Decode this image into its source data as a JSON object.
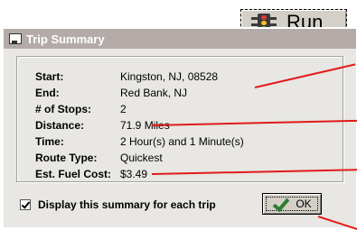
{
  "toolbar": {
    "run_label": "Run"
  },
  "dialog": {
    "title": "Trip Summary",
    "rows": [
      {
        "key": "Start:",
        "value": "Kingston, NJ, 08528"
      },
      {
        "key": "End:",
        "value": "Red Bank, NJ"
      },
      {
        "key": "# of Stops:",
        "value": "2"
      },
      {
        "key": "Distance:",
        "value": "71.9 Miles"
      },
      {
        "key": "Time:",
        "value": "2 Hour(s) and 1 Minute(s)"
      },
      {
        "key": "Route Type:",
        "value": "Quickest"
      },
      {
        "key": "Est. Fuel Cost:",
        "value": "$3.49"
      }
    ],
    "display_summary_label": "Display this summary for each trip",
    "ok_label": "OK"
  },
  "colors": {
    "callout": "#e21b1b",
    "titlebar": "#b4aba8"
  }
}
